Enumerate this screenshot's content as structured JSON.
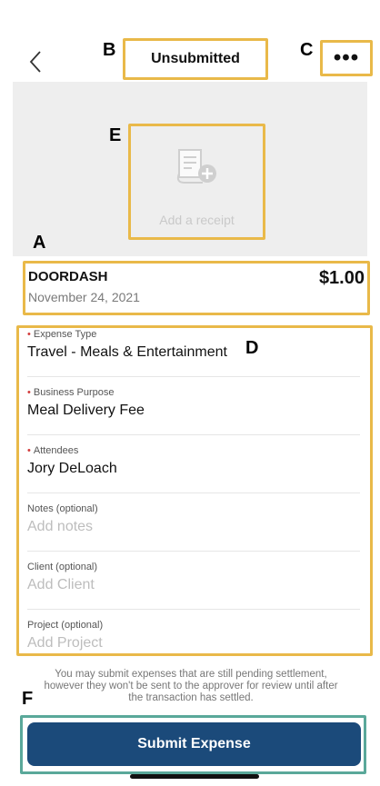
{
  "header": {
    "title": "Unsubmitted",
    "more_label": "•••"
  },
  "receipt": {
    "label": "Add a receipt"
  },
  "transaction": {
    "merchant": "DOORDASH",
    "date": "November 24, 2021",
    "amount": "$1.00"
  },
  "form": {
    "fields": [
      {
        "label": "Expense Type",
        "value": "Travel - Meals & Entertainment"
      },
      {
        "label": "Business Purpose",
        "value": "Meal Delivery Fee"
      },
      {
        "label": "Attendees",
        "value": "Jory DeLoach"
      },
      {
        "label": "Notes (optional)",
        "placeholder": "Add notes"
      },
      {
        "label": "Client (optional)",
        "placeholder": "Add Client"
      },
      {
        "label": "Project  (optional)",
        "placeholder": "Add Project"
      }
    ],
    "required_marker": "•"
  },
  "note": "You may submit expenses that are still pending settlement, however they won't be sent to the approver for review until after the transaction has settled.",
  "submit_label": "Submit Expense",
  "callouts": {
    "a": "A",
    "b": "B",
    "c": "C",
    "d": "D",
    "e": "E",
    "f": "F"
  },
  "colors": {
    "highlight": "#e9b949",
    "highlight_submit": "#5aa89a",
    "primary_button": "#1b4a7a",
    "required": "#d23b3b"
  }
}
